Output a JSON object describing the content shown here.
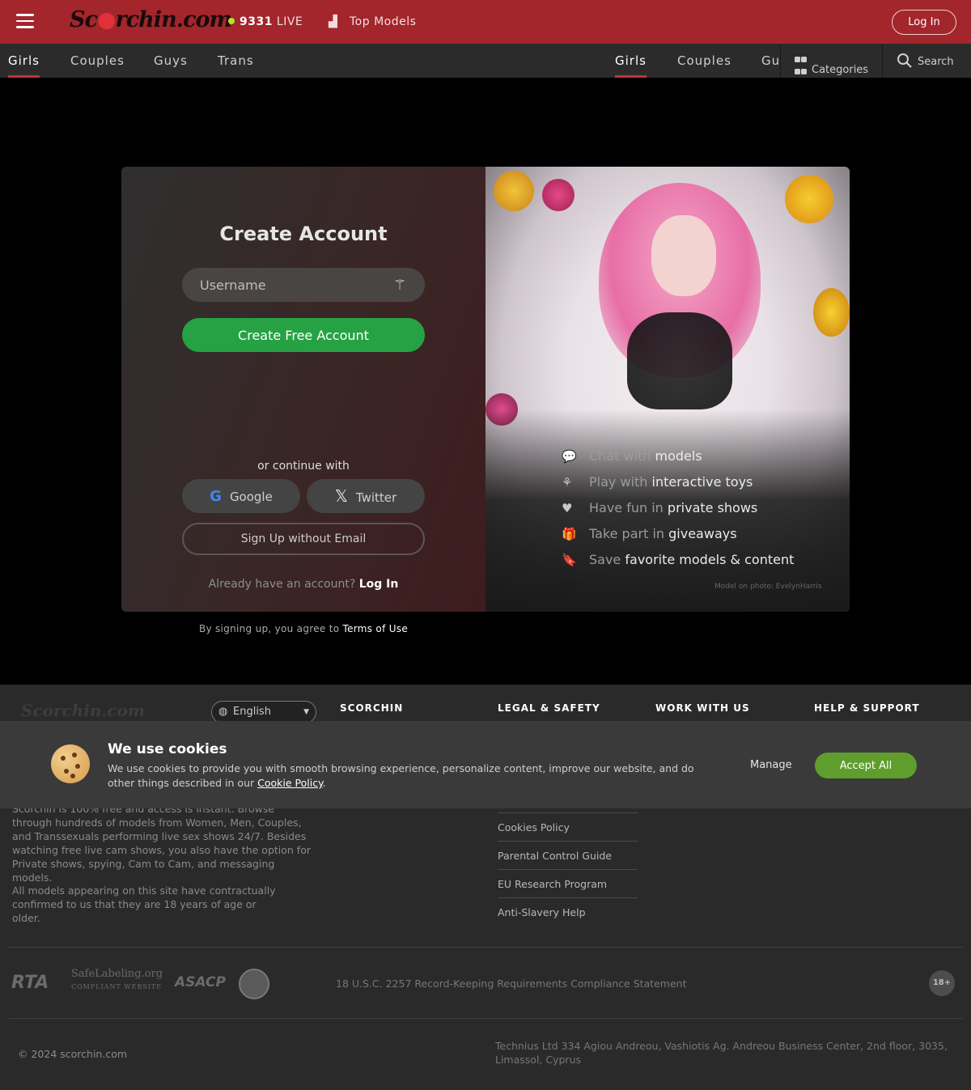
{
  "header": {
    "logo": {
      "text_a": "Sc",
      "text_b": "rchin.com"
    },
    "live_count": "9331",
    "live_label": "LIVE",
    "top_models": "Top Models",
    "login": "Log In"
  },
  "nav": {
    "left": [
      "Girls",
      "Couples",
      "Guys",
      "Trans"
    ],
    "right": [
      "Girls",
      "Couples",
      "Gu"
    ],
    "categories": "Categories",
    "search": "Search"
  },
  "signup": {
    "title": "Create Account",
    "username_placeholder": "Username",
    "create_button": "Create Free Account",
    "or_continue": "or continue with",
    "google": "Google",
    "twitter": "Twitter",
    "no_email": "Sign Up without Email",
    "have_account": "Already have an account?",
    "login_link": "Log In",
    "terms_prefix": "By signing up, you agree to",
    "terms_link": "Terms of Use"
  },
  "features": [
    {
      "dim": "Chat with",
      "bright": "models",
      "icon": "chat-icon"
    },
    {
      "dim": "Play with",
      "bright": "interactive toys",
      "icon": "toy-icon"
    },
    {
      "dim": "Have fun in",
      "bright": "private shows",
      "icon": "heart-icon"
    },
    {
      "dim": "Take part in",
      "bright": "giveaways",
      "icon": "gift-icon"
    },
    {
      "dim": "Save",
      "bright": "favorite models & content",
      "icon": "bookmark-icon"
    }
  ],
  "photo_credit": "Model on photo: EvelynHarris",
  "footer": {
    "logo": "Scorchin.com",
    "language": "English",
    "headings": [
      "SCORCHIN",
      "LEGAL & SAFETY",
      "WORK WITH US",
      "HELP & SUPPORT"
    ],
    "description_1": "Scorchin is 100% free and access is instant. Browse through hundreds of models from Women, Men, Couples, and Transsexuals performing live sex shows 24/7. Besides watching free live cam shows, you also have the option for Private shows, spying, Cam to Cam, and messaging models.",
    "description_2": "All models appearing on this site have contractually confirmed to us that they are 18 years of age or older.",
    "legal_links": [
      "Cookies Policy",
      "Parental Control Guide",
      "EU Research Program",
      "Anti-Slavery Help"
    ],
    "badges": [
      "RTA",
      "SafeLabeling.org",
      "COMPLIANT WEBSITE",
      "ASACP"
    ],
    "usc_statement": "18 U.S.C. 2257 Record-Keeping Requirements Compliance Statement",
    "age_badge": "18+",
    "copyright": "© 2024 scorchin.com",
    "address": "Technius Ltd 334 Agiou Andreou, Vashiotis Ag. Andreou Business Center, 2nd floor, 3035, Limassol, Cyprus"
  },
  "cookie_bar": {
    "title": "We use cookies",
    "text": "We use cookies to provide you with smooth browsing experience, personalize content, improve our website, and do other things described in our",
    "policy_link": "Cookie Policy",
    "manage": "Manage",
    "accept": "Accept All"
  },
  "colors": {
    "brand": "#a2262c",
    "nav_bg": "#2b2b2b",
    "cta_green": "#26a244",
    "accept_green": "#5f9e2d",
    "live_dot": "#b5e02e"
  }
}
